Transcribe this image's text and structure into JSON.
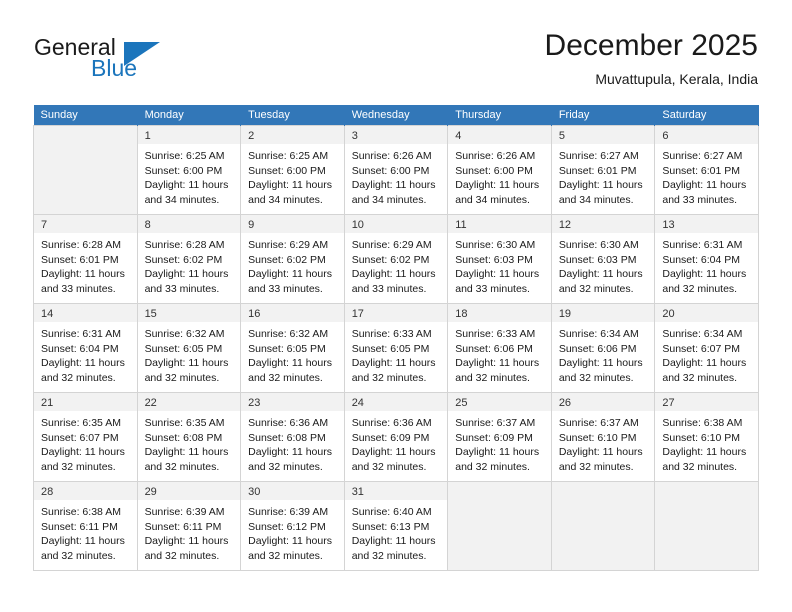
{
  "brand": {
    "name_part1": "General",
    "name_part2": "Blue"
  },
  "header": {
    "month_title": "December 2025",
    "location": "Muvattupula, Kerala, India"
  },
  "colors": {
    "header_row": "#3277b8",
    "brand_blue": "#1b75bc",
    "cell_daynum_bg": "#f2f2f2",
    "grid_border": "#d4d4d4"
  },
  "weekday_headers": [
    "Sunday",
    "Monday",
    "Tuesday",
    "Wednesday",
    "Thursday",
    "Friday",
    "Saturday"
  ],
  "weeks": [
    [
      {
        "day": "",
        "empty": true
      },
      {
        "day": "1",
        "sunrise": "Sunrise: 6:25 AM",
        "sunset": "Sunset: 6:00 PM",
        "daylight1": "Daylight: 11 hours",
        "daylight2": "and 34 minutes."
      },
      {
        "day": "2",
        "sunrise": "Sunrise: 6:25 AM",
        "sunset": "Sunset: 6:00 PM",
        "daylight1": "Daylight: 11 hours",
        "daylight2": "and 34 minutes."
      },
      {
        "day": "3",
        "sunrise": "Sunrise: 6:26 AM",
        "sunset": "Sunset: 6:00 PM",
        "daylight1": "Daylight: 11 hours",
        "daylight2": "and 34 minutes."
      },
      {
        "day": "4",
        "sunrise": "Sunrise: 6:26 AM",
        "sunset": "Sunset: 6:00 PM",
        "daylight1": "Daylight: 11 hours",
        "daylight2": "and 34 minutes."
      },
      {
        "day": "5",
        "sunrise": "Sunrise: 6:27 AM",
        "sunset": "Sunset: 6:01 PM",
        "daylight1": "Daylight: 11 hours",
        "daylight2": "and 34 minutes."
      },
      {
        "day": "6",
        "sunrise": "Sunrise: 6:27 AM",
        "sunset": "Sunset: 6:01 PM",
        "daylight1": "Daylight: 11 hours",
        "daylight2": "and 33 minutes."
      }
    ],
    [
      {
        "day": "7",
        "sunrise": "Sunrise: 6:28 AM",
        "sunset": "Sunset: 6:01 PM",
        "daylight1": "Daylight: 11 hours",
        "daylight2": "and 33 minutes."
      },
      {
        "day": "8",
        "sunrise": "Sunrise: 6:28 AM",
        "sunset": "Sunset: 6:02 PM",
        "daylight1": "Daylight: 11 hours",
        "daylight2": "and 33 minutes."
      },
      {
        "day": "9",
        "sunrise": "Sunrise: 6:29 AM",
        "sunset": "Sunset: 6:02 PM",
        "daylight1": "Daylight: 11 hours",
        "daylight2": "and 33 minutes."
      },
      {
        "day": "10",
        "sunrise": "Sunrise: 6:29 AM",
        "sunset": "Sunset: 6:02 PM",
        "daylight1": "Daylight: 11 hours",
        "daylight2": "and 33 minutes."
      },
      {
        "day": "11",
        "sunrise": "Sunrise: 6:30 AM",
        "sunset": "Sunset: 6:03 PM",
        "daylight1": "Daylight: 11 hours",
        "daylight2": "and 33 minutes."
      },
      {
        "day": "12",
        "sunrise": "Sunrise: 6:30 AM",
        "sunset": "Sunset: 6:03 PM",
        "daylight1": "Daylight: 11 hours",
        "daylight2": "and 32 minutes."
      },
      {
        "day": "13",
        "sunrise": "Sunrise: 6:31 AM",
        "sunset": "Sunset: 6:04 PM",
        "daylight1": "Daylight: 11 hours",
        "daylight2": "and 32 minutes."
      }
    ],
    [
      {
        "day": "14",
        "sunrise": "Sunrise: 6:31 AM",
        "sunset": "Sunset: 6:04 PM",
        "daylight1": "Daylight: 11 hours",
        "daylight2": "and 32 minutes."
      },
      {
        "day": "15",
        "sunrise": "Sunrise: 6:32 AM",
        "sunset": "Sunset: 6:05 PM",
        "daylight1": "Daylight: 11 hours",
        "daylight2": "and 32 minutes."
      },
      {
        "day": "16",
        "sunrise": "Sunrise: 6:32 AM",
        "sunset": "Sunset: 6:05 PM",
        "daylight1": "Daylight: 11 hours",
        "daylight2": "and 32 minutes."
      },
      {
        "day": "17",
        "sunrise": "Sunrise: 6:33 AM",
        "sunset": "Sunset: 6:05 PM",
        "daylight1": "Daylight: 11 hours",
        "daylight2": "and 32 minutes."
      },
      {
        "day": "18",
        "sunrise": "Sunrise: 6:33 AM",
        "sunset": "Sunset: 6:06 PM",
        "daylight1": "Daylight: 11 hours",
        "daylight2": "and 32 minutes."
      },
      {
        "day": "19",
        "sunrise": "Sunrise: 6:34 AM",
        "sunset": "Sunset: 6:06 PM",
        "daylight1": "Daylight: 11 hours",
        "daylight2": "and 32 minutes."
      },
      {
        "day": "20",
        "sunrise": "Sunrise: 6:34 AM",
        "sunset": "Sunset: 6:07 PM",
        "daylight1": "Daylight: 11 hours",
        "daylight2": "and 32 minutes."
      }
    ],
    [
      {
        "day": "21",
        "sunrise": "Sunrise: 6:35 AM",
        "sunset": "Sunset: 6:07 PM",
        "daylight1": "Daylight: 11 hours",
        "daylight2": "and 32 minutes."
      },
      {
        "day": "22",
        "sunrise": "Sunrise: 6:35 AM",
        "sunset": "Sunset: 6:08 PM",
        "daylight1": "Daylight: 11 hours",
        "daylight2": "and 32 minutes."
      },
      {
        "day": "23",
        "sunrise": "Sunrise: 6:36 AM",
        "sunset": "Sunset: 6:08 PM",
        "daylight1": "Daylight: 11 hours",
        "daylight2": "and 32 minutes."
      },
      {
        "day": "24",
        "sunrise": "Sunrise: 6:36 AM",
        "sunset": "Sunset: 6:09 PM",
        "daylight1": "Daylight: 11 hours",
        "daylight2": "and 32 minutes."
      },
      {
        "day": "25",
        "sunrise": "Sunrise: 6:37 AM",
        "sunset": "Sunset: 6:09 PM",
        "daylight1": "Daylight: 11 hours",
        "daylight2": "and 32 minutes."
      },
      {
        "day": "26",
        "sunrise": "Sunrise: 6:37 AM",
        "sunset": "Sunset: 6:10 PM",
        "daylight1": "Daylight: 11 hours",
        "daylight2": "and 32 minutes."
      },
      {
        "day": "27",
        "sunrise": "Sunrise: 6:38 AM",
        "sunset": "Sunset: 6:10 PM",
        "daylight1": "Daylight: 11 hours",
        "daylight2": "and 32 minutes."
      }
    ],
    [
      {
        "day": "28",
        "sunrise": "Sunrise: 6:38 AM",
        "sunset": "Sunset: 6:11 PM",
        "daylight1": "Daylight: 11 hours",
        "daylight2": "and 32 minutes."
      },
      {
        "day": "29",
        "sunrise": "Sunrise: 6:39 AM",
        "sunset": "Sunset: 6:11 PM",
        "daylight1": "Daylight: 11 hours",
        "daylight2": "and 32 minutes."
      },
      {
        "day": "30",
        "sunrise": "Sunrise: 6:39 AM",
        "sunset": "Sunset: 6:12 PM",
        "daylight1": "Daylight: 11 hours",
        "daylight2": "and 32 minutes."
      },
      {
        "day": "31",
        "sunrise": "Sunrise: 6:40 AM",
        "sunset": "Sunset: 6:13 PM",
        "daylight1": "Daylight: 11 hours",
        "daylight2": "and 32 minutes."
      },
      {
        "day": "",
        "empty": true
      },
      {
        "day": "",
        "empty": true
      },
      {
        "day": "",
        "empty": true
      }
    ]
  ]
}
